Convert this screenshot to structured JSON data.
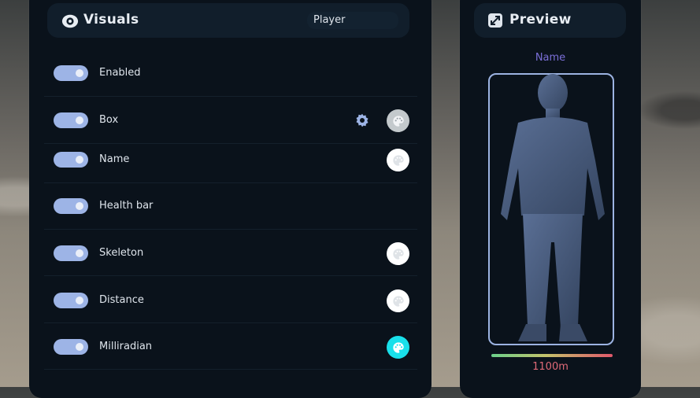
{
  "visuals": {
    "title": "Visuals",
    "selector_value": "Player",
    "rows": [
      {
        "label": "Enabled",
        "enabled": true
      },
      {
        "label": "Box",
        "enabled": true
      },
      {
        "label": "Name",
        "enabled": true
      },
      {
        "label": "Health bar",
        "enabled": true
      },
      {
        "label": "Skeleton",
        "enabled": true
      },
      {
        "label": "Distance",
        "enabled": true
      },
      {
        "label": "Milliradian",
        "enabled": true
      }
    ]
  },
  "preview": {
    "title": "Preview",
    "name_text": "Name",
    "distance_text": "1100m"
  },
  "colors": {
    "accent": "#9db4e6",
    "name_color": "#7b6fd8",
    "distance_color": "#e06a78",
    "milliradian_swatch": "#19e0ea",
    "box_swatch": "#c3c9cc",
    "default_swatch": "#ffffff"
  },
  "icons": [
    "eye-icon",
    "expand-icon",
    "gear-icon",
    "palette-icon"
  ]
}
